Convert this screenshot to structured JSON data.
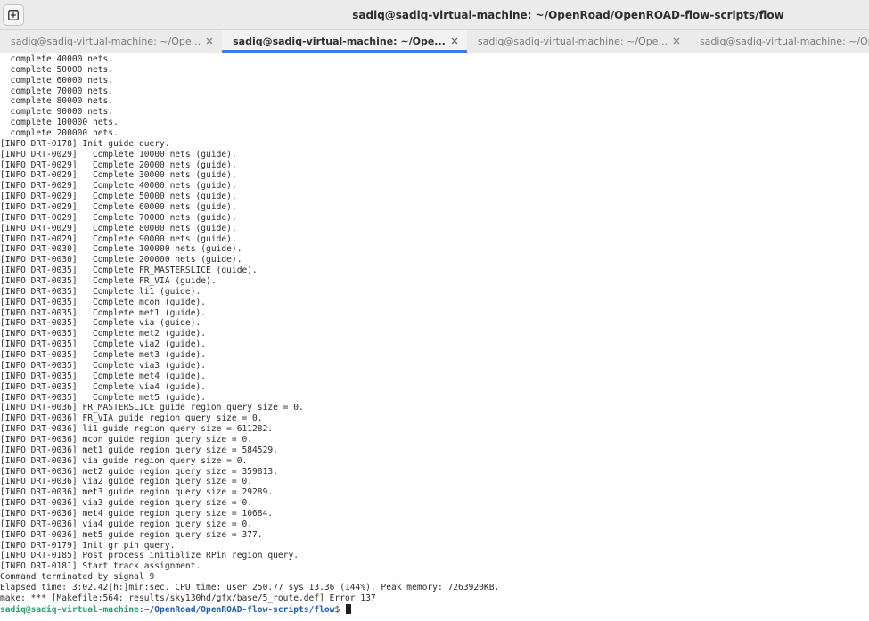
{
  "window": {
    "title": "sadiq@sadiq-virtual-machine: ~/OpenRoad/OpenROAD-flow-scripts/flow"
  },
  "tabs": [
    {
      "label": "sadiq@sadiq-virtual-machine: ~/Ope...",
      "active": false
    },
    {
      "label": "sadiq@sadiq-virtual-machine: ~/Ope...",
      "active": true
    },
    {
      "label": "sadiq@sadiq-virtual-machine: ~/Ope...",
      "active": false
    },
    {
      "label": "sadiq@sadiq-virtual-machine: ~/Ope...",
      "active": false
    }
  ],
  "terminal": {
    "lines": [
      "  complete 40000 nets.",
      "  complete 50000 nets.",
      "  complete 60000 nets.",
      "  complete 70000 nets.",
      "  complete 80000 nets.",
      "  complete 90000 nets.",
      "  complete 100000 nets.",
      "  complete 200000 nets.",
      "[INFO DRT-0178] Init guide query.",
      "[INFO DRT-0029]   Complete 10000 nets (guide).",
      "[INFO DRT-0029]   Complete 20000 nets (guide).",
      "[INFO DRT-0029]   Complete 30000 nets (guide).",
      "[INFO DRT-0029]   Complete 40000 nets (guide).",
      "[INFO DRT-0029]   Complete 50000 nets (guide).",
      "[INFO DRT-0029]   Complete 60000 nets (guide).",
      "[INFO DRT-0029]   Complete 70000 nets (guide).",
      "[INFO DRT-0029]   Complete 80000 nets (guide).",
      "[INFO DRT-0029]   Complete 90000 nets (guide).",
      "[INFO DRT-0030]   Complete 100000 nets (guide).",
      "[INFO DRT-0030]   Complete 200000 nets (guide).",
      "[INFO DRT-0035]   Complete FR_MASTERSLICE (guide).",
      "[INFO DRT-0035]   Complete FR_VIA (guide).",
      "[INFO DRT-0035]   Complete li1 (guide).",
      "[INFO DRT-0035]   Complete mcon (guide).",
      "[INFO DRT-0035]   Complete met1 (guide).",
      "[INFO DRT-0035]   Complete via (guide).",
      "[INFO DRT-0035]   Complete met2 (guide).",
      "[INFO DRT-0035]   Complete via2 (guide).",
      "[INFO DRT-0035]   Complete met3 (guide).",
      "[INFO DRT-0035]   Complete via3 (guide).",
      "[INFO DRT-0035]   Complete met4 (guide).",
      "[INFO DRT-0035]   Complete via4 (guide).",
      "[INFO DRT-0035]   Complete met5 (guide).",
      "[INFO DRT-0036] FR_MASTERSLICE guide region query size = 0.",
      "[INFO DRT-0036] FR_VIA guide region query size = 0.",
      "[INFO DRT-0036] li1 guide region query size = 611282.",
      "[INFO DRT-0036] mcon guide region query size = 0.",
      "[INFO DRT-0036] met1 guide region query size = 584529.",
      "[INFO DRT-0036] via guide region query size = 0.",
      "[INFO DRT-0036] met2 guide region query size = 359813.",
      "[INFO DRT-0036] via2 guide region query size = 0.",
      "[INFO DRT-0036] met3 guide region query size = 29289.",
      "[INFO DRT-0036] via3 guide region query size = 0.",
      "[INFO DRT-0036] met4 guide region query size = 10684.",
      "[INFO DRT-0036] via4 guide region query size = 0.",
      "[INFO DRT-0036] met5 guide region query size = 377.",
      "[INFO DRT-0179] Init gr pin query.",
      "[INFO DRT-0185] Post process initialize RPin region query.",
      "[INFO DRT-0181] Start track assignment.",
      "Command terminated by signal 9",
      "Elapsed time: 3:02.42[h:]min:sec. CPU time: user 250.77 sys 13.36 (144%). Peak memory: 7263920KB.",
      "make: *** [Makefile:564: results/sky130hd/gfx/base/5_route.def] Error 137"
    ],
    "prompt": {
      "user_host": "sadiq@sadiq-virtual-machine",
      "separator": ":",
      "path": "~/OpenRoad/OpenROAD-flow-scripts/flow",
      "symbol": "$ "
    }
  },
  "colors": {
    "prompt_user": "#26a269",
    "prompt_path": "#1c5cb8",
    "active_tab_underline": "#3584e4"
  },
  "icons": {
    "new_tab": "new-tab-icon",
    "tab_close": "close-icon"
  }
}
